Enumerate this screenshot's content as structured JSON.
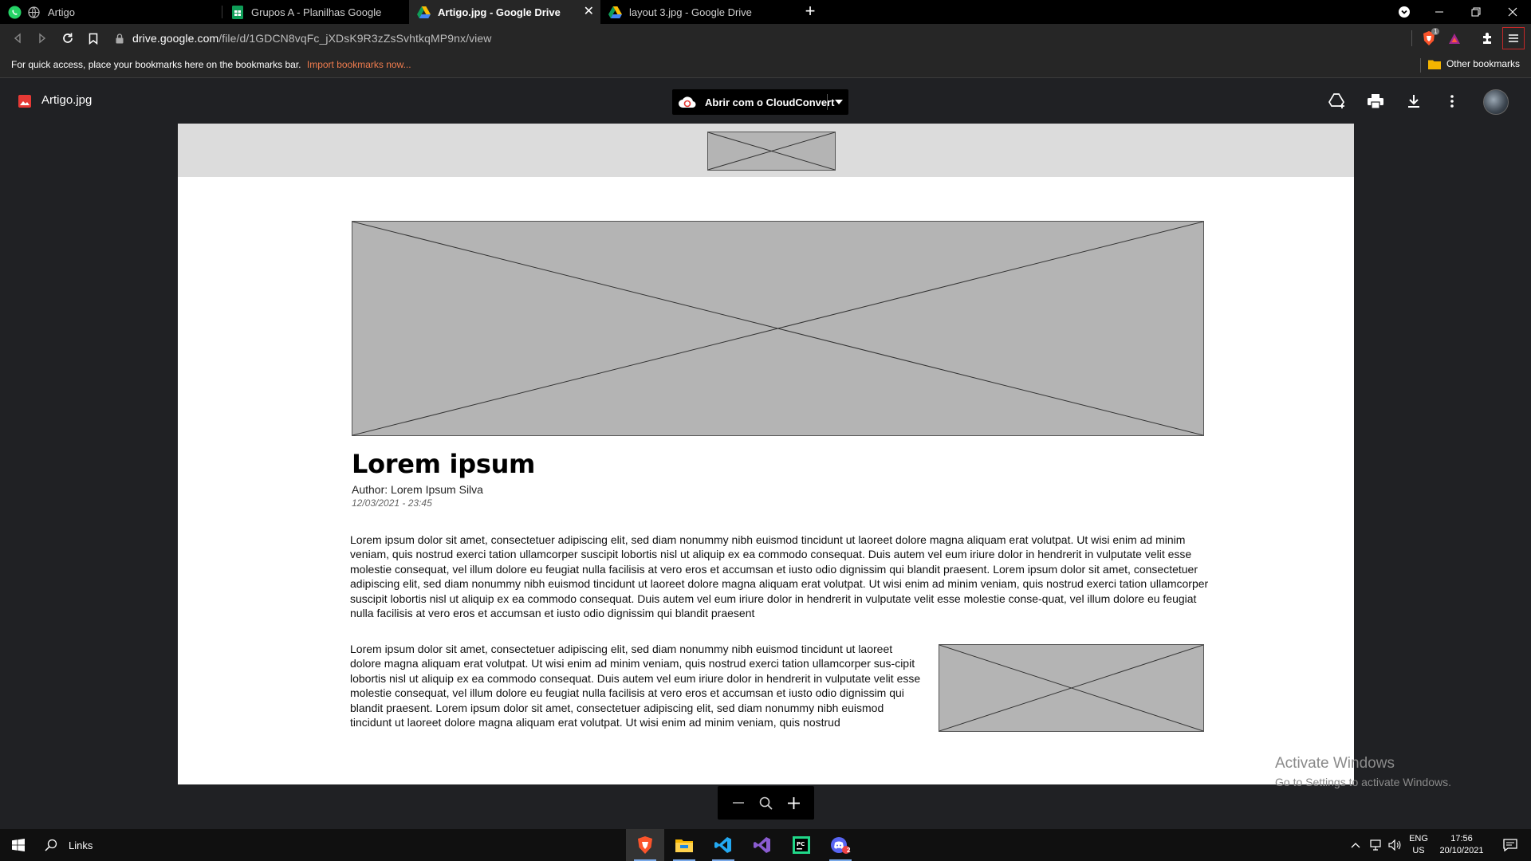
{
  "browser": {
    "tabs": [
      {
        "label": "Artigo",
        "icon": "whatsapp-icon"
      },
      {
        "label": "Grupos A - Planilhas Google",
        "icon": "sheets-icon"
      },
      {
        "label": "Artigo.jpg - Google Drive",
        "icon": "drive-icon",
        "active": true
      },
      {
        "label": "layout 3.jpg - Google Drive",
        "icon": "drive-icon"
      }
    ],
    "new_tab": "+",
    "close_tab": "✕",
    "url_host": "drive.google.com",
    "url_path": "/file/d/1GDCN8vqFc_jXDsK9R3zZsSvhtkqMP9nx/view",
    "extension_badge": "1"
  },
  "bookmarks": {
    "hint": "For quick access, place your bookmarks here on the bookmarks bar.",
    "import_link": "Import bookmarks now...",
    "other": "Other bookmarks"
  },
  "viewer": {
    "filename": "Artigo.jpg",
    "open_with": "Abrir com o CloudConvert"
  },
  "document": {
    "title": "Lorem ipsum",
    "author": "Author: Lorem Ipsum Silva",
    "date": "12/03/2021 - 23:45",
    "paragraph1": "Lorem ipsum dolor sit amet, consectetuer adipiscing elit, sed diam nonummy nibh euismod tincidunt ut laoreet dolore magna aliquam erat volutpat. Ut wisi enim ad minim veniam, quis nostrud exerci tation ullamcorper suscipit lobortis nisl ut aliquip ex ea commodo consequat. Duis autem vel eum iriure dolor in hendrerit in vulputate velit esse molestie consequat, vel illum dolore eu feugiat nulla facilisis at vero eros et accumsan et iusto odio dignissim qui blandit praesent. Lorem ipsum dolor sit amet, consectetuer adipiscing elit, sed diam nonummy nibh euismod tincidunt ut laoreet dolore magna aliquam erat volutpat. Ut wisi enim ad minim veniam, quis nostrud exerci tation ullamcorper suscipit lobortis nisl ut aliquip ex ea commodo consequat. Duis autem vel eum iriure dolor in hendrerit in vulputate velit esse molestie conse-quat, vel illum dolore eu feugiat nulla facilisis at vero eros et accumsan et iusto odio dignissim qui blandit praesent",
    "paragraph2": "Lorem ipsum dolor sit amet, consectetuer adipiscing elit, sed diam nonummy nibh euismod tincidunt ut laoreet dolore magna aliquam erat volutpat. Ut wisi enim ad minim veniam, quis nostrud exerci tation ullamcorper sus-cipit lobortis nisl ut aliquip ex ea commodo consequat. Duis autem vel eum iriure dolor in hendrerit in vulputate velit esse molestie consequat, vel illum dolore eu feugiat nulla facilisis at vero eros et accumsan et iusto odio dignissim qui blandit praesent. Lorem ipsum dolor sit amet, consectetuer adipiscing elit, sed diam nonummy nibh euismod tincidunt ut laoreet dolore magna aliquam erat volutpat. Ut wisi enim ad minim veniam, quis nostrud"
  },
  "watermark": {
    "line1": "Activate Windows",
    "line2": "Go to Settings to activate Windows."
  },
  "taskbar": {
    "search_label": "Links",
    "lang_line1": "ENG",
    "lang_line2": "US",
    "time": "17:56",
    "date": "20/10/2021",
    "notification_count": "2"
  },
  "colors": {
    "accent_import": "#f07c4e",
    "drive_file_red": "#e53935",
    "placeholder_gray": "#b4b4b4"
  }
}
